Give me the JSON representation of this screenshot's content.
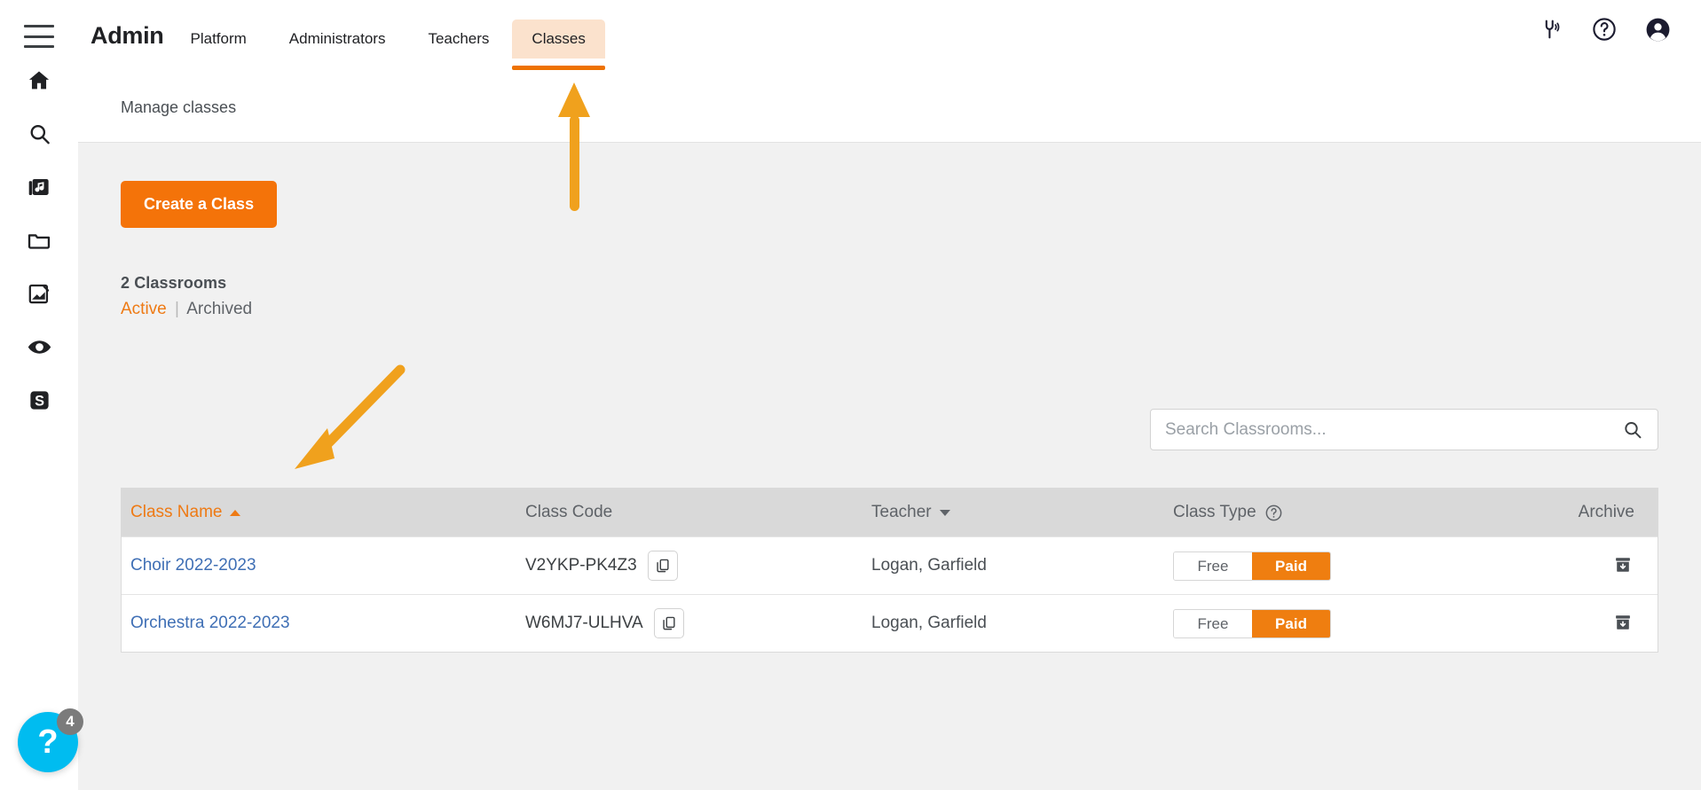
{
  "colors": {
    "brand_orange": "#f47309",
    "tab_highlight": "#fbe2cd",
    "tab_underline": "#ee7203",
    "link_blue": "#3f6fb5",
    "annotation_orange": "#f0a11d",
    "help_cyan": "#00bcf0",
    "badge_gray": "#7b7b7b",
    "table_header_gray": "#d9d9d9",
    "page_bg": "#f1f1f1"
  },
  "rail": {
    "menu_icon": "hamburger-menu-icon",
    "items": [
      {
        "icon": "home-icon",
        "name": "home"
      },
      {
        "icon": "search-icon",
        "name": "search"
      },
      {
        "icon": "music-library-icon",
        "name": "music-library"
      },
      {
        "icon": "folder-icon",
        "name": "folder"
      },
      {
        "icon": "compose-icon",
        "name": "compose"
      },
      {
        "icon": "eye-icon",
        "name": "preview"
      },
      {
        "icon": "s-badge-icon",
        "name": "sight-reading"
      }
    ]
  },
  "header": {
    "brand": "Admin",
    "tabs": [
      {
        "label": "Platform",
        "active": false
      },
      {
        "label": "Administrators",
        "active": false
      },
      {
        "label": "Teachers",
        "active": false
      },
      {
        "label": "Classes",
        "active": true
      }
    ],
    "actions": [
      {
        "icon": "tuning-fork-icon",
        "name": "tuner"
      },
      {
        "icon": "help-circle-icon",
        "name": "help"
      },
      {
        "icon": "account-circle-icon",
        "name": "account"
      }
    ]
  },
  "subheader": {
    "breadcrumb": "Manage classes"
  },
  "main": {
    "create_button": "Create a Class",
    "count": "2 Classrooms",
    "filter_active": "Active",
    "filter_separator": "|",
    "filter_archived": "Archived",
    "search": {
      "placeholder": "Search Classrooms...",
      "value": "",
      "icon": "search-icon"
    }
  },
  "table": {
    "columns": [
      {
        "label": "Class Name",
        "sorted": true,
        "sort_dir": "asc"
      },
      {
        "label": "Class Code",
        "sorted": false
      },
      {
        "label": "Teacher",
        "sorted": false,
        "sort_dir": "desc"
      },
      {
        "label": "Class Type",
        "sorted": false,
        "has_help": true
      },
      {
        "label": "Archive",
        "sorted": false
      }
    ],
    "rows": [
      {
        "class_name": "Choir 2022-2023",
        "class_code": "V2YKP-PK4Z3",
        "copy_icon": "copy-icon",
        "teacher": "Logan, Garfield",
        "type_free_label": "Free",
        "type_paid_label": "Paid",
        "type_selected": "Paid",
        "archive_icon": "archive-box-icon"
      },
      {
        "class_name": "Orchestra 2022-2023",
        "class_code": "W6MJ7-ULHVA",
        "copy_icon": "copy-icon",
        "teacher": "Logan, Garfield",
        "type_free_label": "Free",
        "type_paid_label": "Paid",
        "type_selected": "Paid",
        "archive_icon": "archive-box-icon"
      }
    ]
  },
  "help_widget": {
    "glyph": "?",
    "badge_count": "4"
  },
  "annotations": [
    {
      "name": "arrow-pointing-at-classes-tab",
      "direction": "up",
      "target": "Classes"
    },
    {
      "name": "arrow-pointing-at-orchestra-class",
      "direction": "down-left",
      "target": "Orchestra 2022-2023"
    }
  ]
}
